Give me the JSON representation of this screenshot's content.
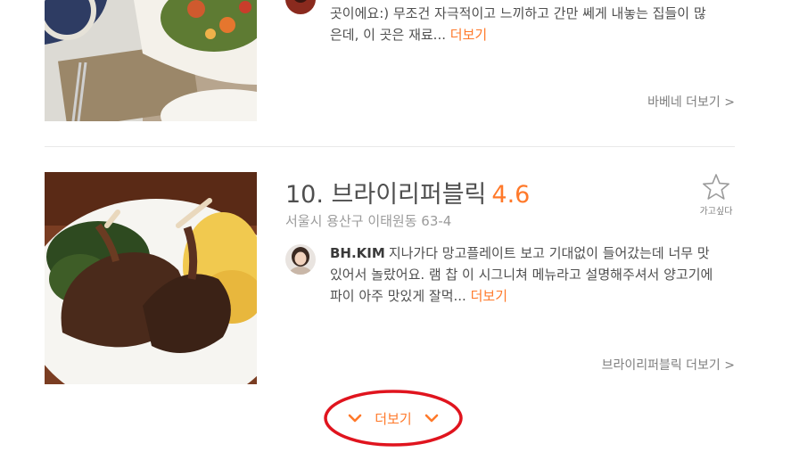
{
  "previous_item": {
    "review_text": "곳이에요:) 무조건 자극적이고 느끼하고 간만 쎄게 내놓는 집들이 많은데, 이 곳은 재료...",
    "review_more": "더보기",
    "see_more": "바베네 더보기 >"
  },
  "current_item": {
    "rank_name": "10. 브라이리퍼블릭",
    "score": "4.6",
    "address": "서울시 용산구 이태원동 63-4",
    "wish_label": "가고싶다",
    "wish_icon": "star-outline-icon",
    "reviewer": "BH.KIM",
    "review_text": "지나가다 망고플레이트 보고 기대없이 들어갔는데 너무 맛있어서 놀랐어요. 램 찹 이 시그니쳐 메뉴라고 설명해주셔서 양고기에 파이 아주 맛있게 잘먹...",
    "review_more": "더보기",
    "see_more": "브라이리퍼블릭 더보기 >"
  },
  "load_more": {
    "label": "더보기",
    "icon": "chevron-down-icon"
  },
  "colors": {
    "accent": "#ff792a",
    "annotation": "#e0141e",
    "text": "#4f4f4f",
    "muted": "#9b9b9b"
  }
}
